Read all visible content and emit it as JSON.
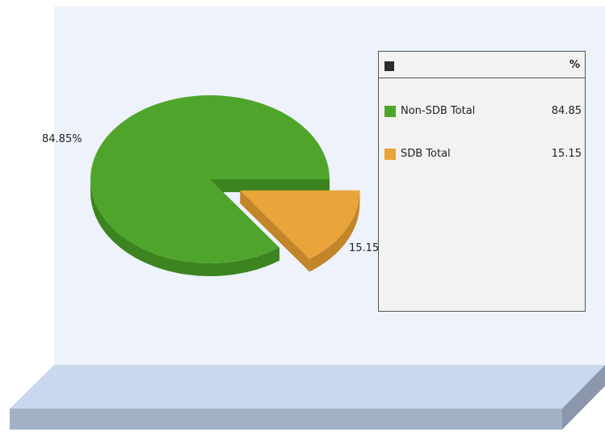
{
  "chart_data": {
    "type": "pie",
    "title": "",
    "slices": [
      {
        "label": "Non-SDB Total",
        "value": 84.85,
        "display": "84.85%",
        "legend_value": "84.85",
        "color": "#4fa52b",
        "side": "#3c8420"
      },
      {
        "label": "SDB Total",
        "value": 15.15,
        "display": "15.15%",
        "legend_value": "15.15",
        "color": "#e9a43a",
        "side": "#c2852a"
      }
    ],
    "legend": {
      "placement": "right",
      "value_header": "%"
    },
    "colors": {
      "wall": "#edf2fb",
      "floor_top": "#c9d8ee",
      "floor_front": "#a3b1c7",
      "floor_side": "#8a97ad"
    }
  }
}
